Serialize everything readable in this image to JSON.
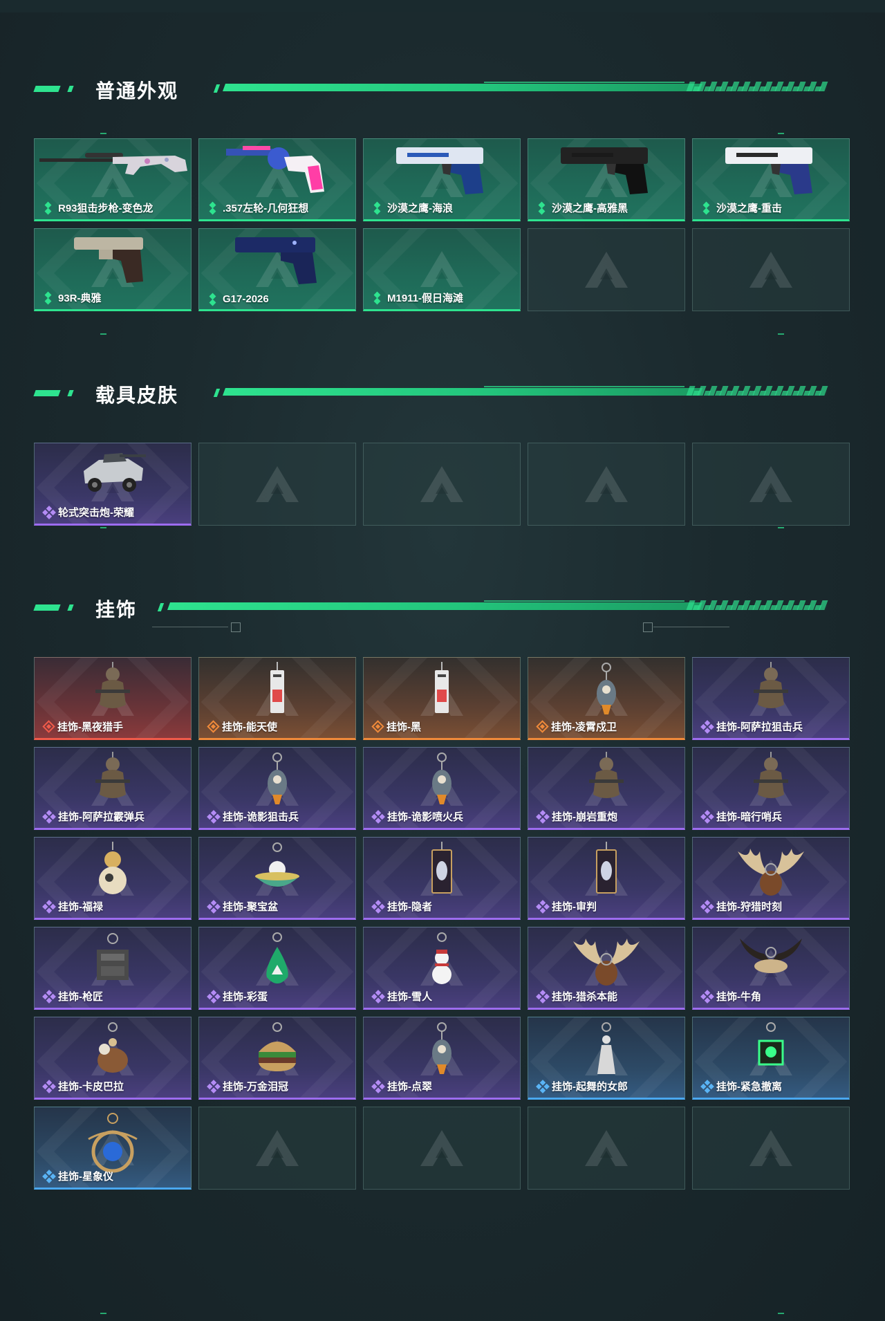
{
  "sections": [
    {
      "title": "普通外观",
      "items": [
        {
          "label": "R93狙击步枪-变色龙",
          "rarity": "green",
          "art": "sniper"
        },
        {
          "label": ".357左轮-几何狂想",
          "rarity": "green",
          "art": "revolver"
        },
        {
          "label": "沙漠之鹰-海浪",
          "rarity": "green",
          "art": "pistol-blue"
        },
        {
          "label": "沙漠之鹰-高雅黑",
          "rarity": "green",
          "art": "pistol-black"
        },
        {
          "label": "沙漠之鹰-重击",
          "rarity": "green",
          "art": "pistol-white"
        },
        {
          "label": "93R-典雅",
          "rarity": "green",
          "art": "pistol-beige"
        },
        {
          "label": "G17-2026",
          "rarity": "green",
          "art": "pistol-navy"
        },
        {
          "label": "M1911-假日海滩",
          "rarity": "green",
          "art": "none"
        },
        {
          "label": "",
          "rarity": "empty"
        },
        {
          "label": "",
          "rarity": "empty"
        }
      ]
    },
    {
      "title": "载具皮肤",
      "items": [
        {
          "label": "轮式突击炮-荣耀",
          "rarity": "purple",
          "art": "vehicle"
        },
        {
          "label": "",
          "rarity": "empty"
        },
        {
          "label": "",
          "rarity": "empty"
        },
        {
          "label": "",
          "rarity": "empty"
        },
        {
          "label": "",
          "rarity": "empty"
        }
      ]
    },
    {
      "title": "挂饰",
      "items": [
        {
          "label": "挂饰-黑夜猎手",
          "rarity": "red",
          "art": "figure"
        },
        {
          "label": "挂饰-能天使",
          "rarity": "orange",
          "art": "tag"
        },
        {
          "label": "挂饰-黑",
          "rarity": "orange",
          "art": "tag"
        },
        {
          "label": "挂饰-凌霄戍卫",
          "rarity": "orange",
          "art": "charm"
        },
        {
          "label": "挂饰-阿萨拉狙击兵",
          "rarity": "purple",
          "art": "figure"
        },
        {
          "label": "挂饰-阿萨拉霰弹兵",
          "rarity": "purple",
          "art": "figure"
        },
        {
          "label": "挂饰-诡影狙击兵",
          "rarity": "purple",
          "art": "charm"
        },
        {
          "label": "挂饰-诡影喷火兵",
          "rarity": "purple",
          "art": "charm"
        },
        {
          "label": "挂饰-崩岩重炮",
          "rarity": "purple",
          "art": "figure"
        },
        {
          "label": "挂饰-暗行哨兵",
          "rarity": "purple",
          "art": "figure"
        },
        {
          "label": "挂饰-福禄",
          "rarity": "purple",
          "art": "gourd"
        },
        {
          "label": "挂饰-聚宝盆",
          "rarity": "purple",
          "art": "bowl"
        },
        {
          "label": "挂饰-隐者",
          "rarity": "purple",
          "art": "card"
        },
        {
          "label": "挂饰-审判",
          "rarity": "purple",
          "art": "card"
        },
        {
          "label": "挂饰-狩猎时刻",
          "rarity": "purple",
          "art": "antler"
        },
        {
          "label": "挂饰-枪匠",
          "rarity": "purple",
          "art": "box"
        },
        {
          "label": "挂饰-彩蛋",
          "rarity": "purple",
          "art": "egg"
        },
        {
          "label": "挂饰-雪人",
          "rarity": "purple",
          "art": "snowman"
        },
        {
          "label": "挂饰-猎杀本能",
          "rarity": "purple",
          "art": "antler"
        },
        {
          "label": "挂饰-牛角",
          "rarity": "purple",
          "art": "horn"
        },
        {
          "label": "挂饰-卡皮巴拉",
          "rarity": "purple",
          "art": "capybara"
        },
        {
          "label": "挂饰-万金泪冠",
          "rarity": "purple",
          "art": "burger"
        },
        {
          "label": "挂饰-点翠",
          "rarity": "purple",
          "art": "charm"
        },
        {
          "label": "挂饰-起舞的女郎",
          "rarity": "blue",
          "art": "dancer"
        },
        {
          "label": "挂饰-紧急撤离",
          "rarity": "blue",
          "art": "sign"
        },
        {
          "label": "挂饰-星象仪",
          "rarity": "blue",
          "art": "astrolabe"
        },
        {
          "label": "",
          "rarity": "empty"
        },
        {
          "label": "",
          "rarity": "empty"
        },
        {
          "label": "",
          "rarity": "empty"
        },
        {
          "label": "",
          "rarity": "empty"
        }
      ]
    }
  ],
  "colors": {
    "accent": "#2ee38f",
    "green": "#2ee38f",
    "purple": "#9d6cf0",
    "red": "#f05a4a",
    "orange": "#f08a3a",
    "blue": "#4aa8f0"
  }
}
